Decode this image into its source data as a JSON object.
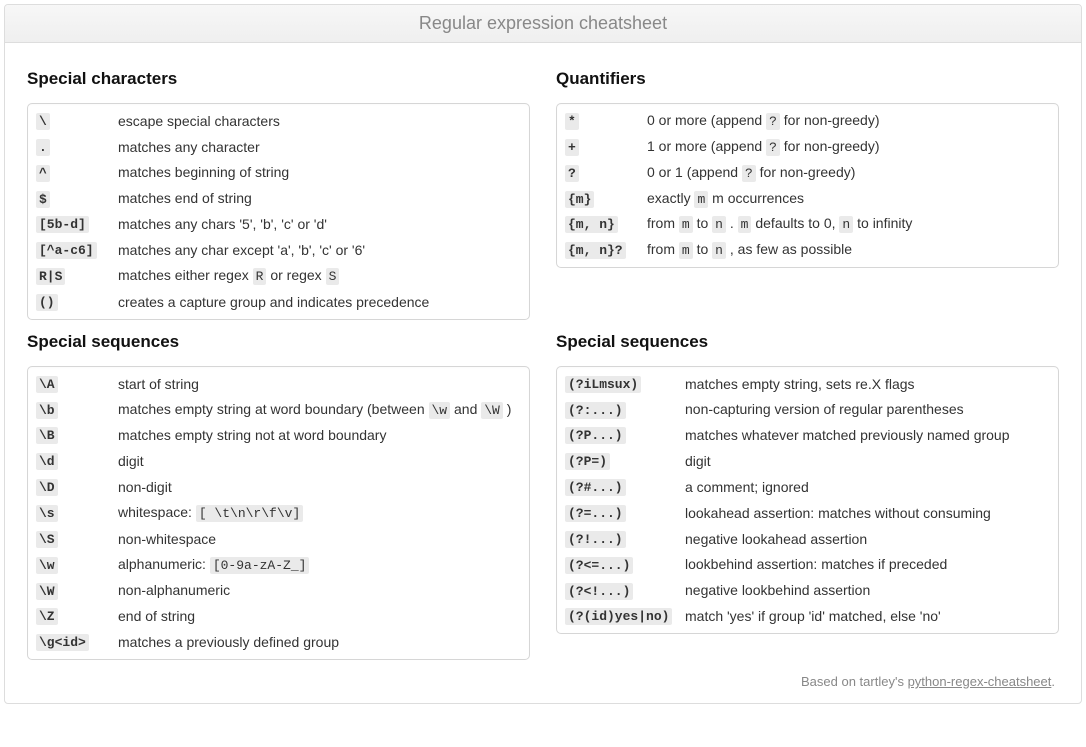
{
  "title": "Regular expression cheatsheet",
  "footer": {
    "prefix": "Based on tartley's ",
    "link": "python-regex-cheatsheet",
    "suffix": "."
  },
  "sections": {
    "special_chars": {
      "heading": "Special characters",
      "rows": [
        {
          "k": "\\",
          "parts": [
            {
              "t": "escape special characters"
            }
          ]
        },
        {
          "k": ".",
          "parts": [
            {
              "t": "matches any character"
            }
          ]
        },
        {
          "k": "^",
          "parts": [
            {
              "t": "matches beginning of string"
            }
          ]
        },
        {
          "k": "$",
          "parts": [
            {
              "t": "matches end of string"
            }
          ]
        },
        {
          "k": "[5b-d]",
          "parts": [
            {
              "t": "matches any chars '5', 'b', 'c' or 'd'"
            }
          ]
        },
        {
          "k": "[^a-c6]",
          "parts": [
            {
              "t": "matches any char except 'a', 'b', 'c' or '6'"
            }
          ]
        },
        {
          "k": "R|S",
          "parts": [
            {
              "t": "matches either regex "
            },
            {
              "c": "R"
            },
            {
              "t": " or regex "
            },
            {
              "c": "S"
            }
          ]
        },
        {
          "k": "()",
          "parts": [
            {
              "t": "creates a capture group and indicates precedence"
            }
          ]
        }
      ]
    },
    "quantifiers": {
      "heading": "Quantifiers",
      "rows": [
        {
          "k": "*",
          "parts": [
            {
              "t": "0 or more (append "
            },
            {
              "c": "?"
            },
            {
              "t": " for non-greedy)"
            }
          ]
        },
        {
          "k": "+",
          "parts": [
            {
              "t": "1 or more (append "
            },
            {
              "c": "?"
            },
            {
              "t": " for non-greedy)"
            }
          ]
        },
        {
          "k": "?",
          "parts": [
            {
              "t": "0 or 1 (append "
            },
            {
              "c": "?"
            },
            {
              "t": " for non-greedy)"
            }
          ]
        },
        {
          "k": "{m}",
          "parts": [
            {
              "t": "exactly "
            },
            {
              "c": "m"
            },
            {
              "t": " m occurrences"
            }
          ]
        },
        {
          "k": "{m, n}",
          "parts": [
            {
              "t": "from "
            },
            {
              "c": "m"
            },
            {
              "t": " to "
            },
            {
              "c": "n"
            },
            {
              "t": " . "
            },
            {
              "c": "m"
            },
            {
              "t": " defaults to 0, "
            },
            {
              "c": "n"
            },
            {
              "t": " to infinity"
            }
          ]
        },
        {
          "k": "{m, n}?",
          "parts": [
            {
              "t": "from "
            },
            {
              "c": "m"
            },
            {
              "t": " to "
            },
            {
              "c": "n"
            },
            {
              "t": " , as few as possible"
            }
          ]
        }
      ]
    },
    "special_seq_left": {
      "heading": "Special sequences",
      "rows": [
        {
          "k": "\\A",
          "parts": [
            {
              "t": "start of string"
            }
          ]
        },
        {
          "k": "\\b",
          "parts": [
            {
              "t": "matches empty string at word boundary (between "
            },
            {
              "c": "\\w"
            },
            {
              "t": " and "
            },
            {
              "c": "\\W"
            },
            {
              "t": " )"
            }
          ]
        },
        {
          "k": "\\B",
          "parts": [
            {
              "t": "matches empty string not at word boundary"
            }
          ]
        },
        {
          "k": "\\d",
          "parts": [
            {
              "t": "digit"
            }
          ]
        },
        {
          "k": "\\D",
          "parts": [
            {
              "t": "non-digit"
            }
          ]
        },
        {
          "k": "\\s",
          "parts": [
            {
              "t": "whitespace: "
            },
            {
              "c": "[ \\t\\n\\r\\f\\v]"
            }
          ]
        },
        {
          "k": "\\S",
          "parts": [
            {
              "t": "non-whitespace"
            }
          ]
        },
        {
          "k": "\\w",
          "parts": [
            {
              "t": "alphanumeric: "
            },
            {
              "c": "[0-9a-zA-Z_]"
            }
          ]
        },
        {
          "k": "\\W",
          "parts": [
            {
              "t": "non-alphanumeric"
            }
          ]
        },
        {
          "k": "\\Z",
          "parts": [
            {
              "t": "end of string"
            }
          ]
        },
        {
          "k": "\\g<id>",
          "parts": [
            {
              "t": "matches a previously defined group"
            }
          ]
        }
      ]
    },
    "special_seq_right": {
      "heading": "Special sequences",
      "rows": [
        {
          "k": "(?iLmsux)",
          "parts": [
            {
              "t": "matches empty string, sets re.X flags"
            }
          ]
        },
        {
          "k": "(?:...)",
          "parts": [
            {
              "t": "non-capturing version of regular parentheses"
            }
          ]
        },
        {
          "k": "(?P...)",
          "parts": [
            {
              "t": "matches whatever matched previously named group"
            }
          ]
        },
        {
          "k": "(?P=)",
          "parts": [
            {
              "t": "digit"
            }
          ]
        },
        {
          "k": "(?#...)",
          "parts": [
            {
              "t": "a comment; ignored"
            }
          ]
        },
        {
          "k": "(?=...)",
          "parts": [
            {
              "t": "lookahead assertion: matches without consuming"
            }
          ]
        },
        {
          "k": "(?!...)",
          "parts": [
            {
              "t": "negative lookahead assertion"
            }
          ]
        },
        {
          "k": "(?<=...)",
          "parts": [
            {
              "t": "lookbehind assertion: matches if preceded"
            }
          ]
        },
        {
          "k": "(?<!...)",
          "parts": [
            {
              "t": "negative lookbehind assertion"
            }
          ]
        },
        {
          "k": "(?(id)yes|no)",
          "parts": [
            {
              "t": "match 'yes' if group 'id' matched, else 'no'"
            }
          ]
        }
      ]
    }
  }
}
